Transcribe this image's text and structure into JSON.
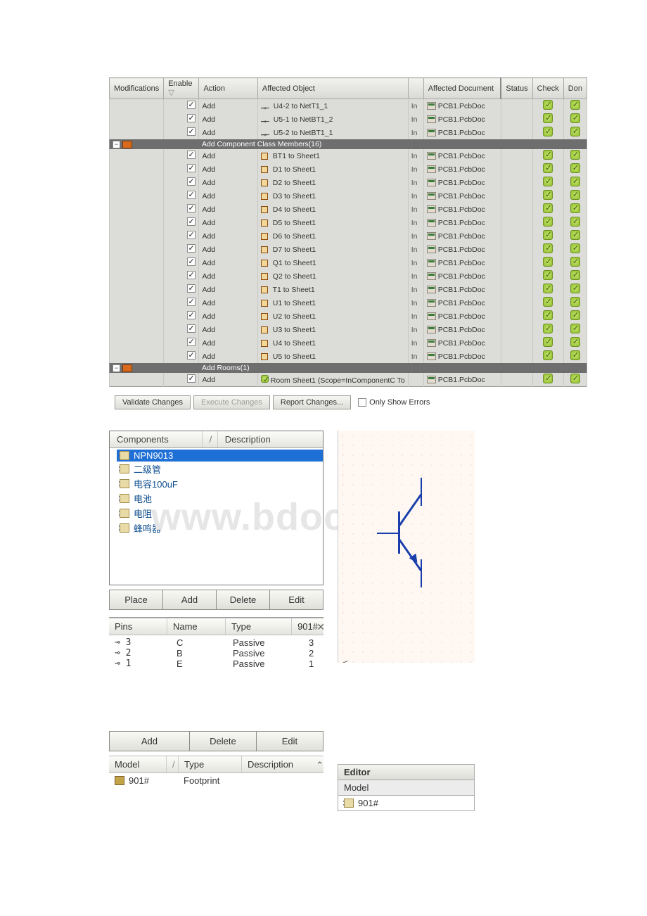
{
  "modifications_header": "Modifications",
  "status_header": "Status",
  "columns": {
    "enable": "Enable",
    "action": "Action",
    "affected_object": "Affected Object",
    "affected_document": "Affected Document",
    "check": "Check",
    "done": "Don"
  },
  "net_rows": [
    {
      "action": "Add",
      "object": "U4-2 to NetT1_1",
      "in": "In",
      "document": "PCB1.PcbDoc"
    },
    {
      "action": "Add",
      "object": "U5-1 to NetBT1_2",
      "in": "In",
      "document": "PCB1.PcbDoc"
    },
    {
      "action": "Add",
      "object": "U5-2 to NetBT1_1",
      "in": "In",
      "document": "PCB1.PcbDoc"
    }
  ],
  "group1_label": "Add Component Class Members(16)",
  "class_rows": [
    {
      "action": "Add",
      "object": "BT1 to Sheet1",
      "in": "In",
      "document": "PCB1.PcbDoc"
    },
    {
      "action": "Add",
      "object": "D1 to Sheet1",
      "in": "In",
      "document": "PCB1.PcbDoc"
    },
    {
      "action": "Add",
      "object": "D2 to Sheet1",
      "in": "In",
      "document": "PCB1.PcbDoc"
    },
    {
      "action": "Add",
      "object": "D3 to Sheet1",
      "in": "In",
      "document": "PCB1.PcbDoc"
    },
    {
      "action": "Add",
      "object": "D4 to Sheet1",
      "in": "In",
      "document": "PCB1.PcbDoc"
    },
    {
      "action": "Add",
      "object": "D5 to Sheet1",
      "in": "In",
      "document": "PCB1.PcbDoc"
    },
    {
      "action": "Add",
      "object": "D6 to Sheet1",
      "in": "In",
      "document": "PCB1.PcbDoc"
    },
    {
      "action": "Add",
      "object": "D7 to Sheet1",
      "in": "In",
      "document": "PCB1.PcbDoc"
    },
    {
      "action": "Add",
      "object": "Q1 to Sheet1",
      "in": "In",
      "document": "PCB1.PcbDoc"
    },
    {
      "action": "Add",
      "object": "Q2 to Sheet1",
      "in": "In",
      "document": "PCB1.PcbDoc"
    },
    {
      "action": "Add",
      "object": "T1 to Sheet1",
      "in": "In",
      "document": "PCB1.PcbDoc"
    },
    {
      "action": "Add",
      "object": "U1 to Sheet1",
      "in": "In",
      "document": "PCB1.PcbDoc"
    },
    {
      "action": "Add",
      "object": "U2 to Sheet1",
      "in": "In",
      "document": "PCB1.PcbDoc"
    },
    {
      "action": "Add",
      "object": "U3 to Sheet1",
      "in": "In",
      "document": "PCB1.PcbDoc"
    },
    {
      "action": "Add",
      "object": "U4 to Sheet1",
      "in": "In",
      "document": "PCB1.PcbDoc"
    },
    {
      "action": "Add",
      "object": "U5 to Sheet1",
      "in": "In",
      "document": "PCB1.PcbDoc"
    }
  ],
  "group2_label": "Add Rooms(1)",
  "room_rows": [
    {
      "action": "Add",
      "object": "Room Sheet1 (Scope=InComponentC To",
      "in": "",
      "document": "PCB1.PcbDoc"
    }
  ],
  "buttons": {
    "validate": "Validate Changes",
    "execute": "Execute Changes",
    "report": "Report Changes...",
    "only_errors": "Only Show Errors"
  },
  "lib": {
    "columns": {
      "components": "Components",
      "description": "Description"
    },
    "items": [
      {
        "label": "NPN9013",
        "selected": true
      },
      {
        "label": "二级管",
        "selected": false
      },
      {
        "label": "电容100uF",
        "selected": false
      },
      {
        "label": "电池",
        "selected": false
      },
      {
        "label": "电阻",
        "selected": false
      },
      {
        "label": "蜂鸣器",
        "selected": false
      }
    ],
    "buttons": {
      "place": "Place",
      "add": "Add",
      "delete": "Delete",
      "edit": "Edit"
    }
  },
  "pins": {
    "columns": {
      "pins": "Pins",
      "name": "Name",
      "type": "Type",
      "num": "901#"
    },
    "rows": [
      {
        "pin": "⊸ 3",
        "name": "C",
        "type": "Passive",
        "num": "3"
      },
      {
        "pin": "⊸ 2",
        "name": "B",
        "type": "Passive",
        "num": "2"
      },
      {
        "pin": "⊸ 1",
        "name": "E",
        "type": "Passive",
        "num": "1"
      }
    ],
    "buttons": {
      "add": "Add",
      "delete": "Delete",
      "edit": "Edit"
    }
  },
  "model_panel": {
    "columns": {
      "model": "Model",
      "type": "Type",
      "description": "Description"
    },
    "row": {
      "model": "901#",
      "type": "Footprint"
    }
  },
  "editor": {
    "label": "Editor",
    "model_label": "Model",
    "item": "901#"
  },
  "watermark": "www.bdocx.com"
}
